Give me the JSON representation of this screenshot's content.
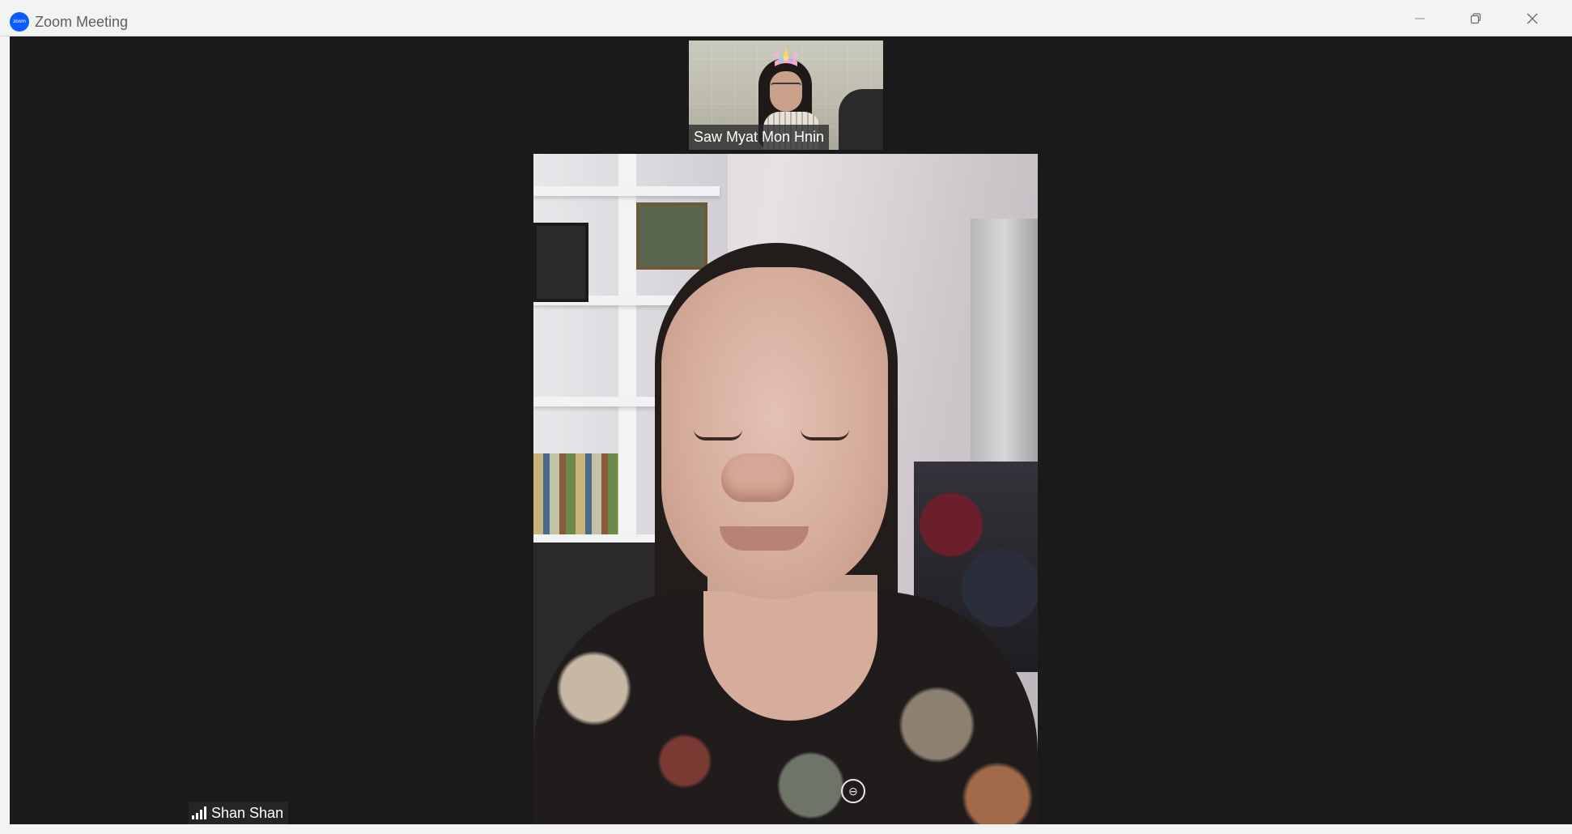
{
  "window": {
    "title": "Zoom Meeting",
    "logo_text": "zoom"
  },
  "controls": {
    "minimize_icon": "minimize-icon",
    "restore_icon": "restore-icon",
    "close_icon": "close-icon"
  },
  "participants": {
    "thumbnail": {
      "name": "Saw Myat Mon Hnin",
      "filter": "unicorn-headband"
    },
    "active_speaker": {
      "name": "Shan Shan",
      "connection_icon": "signal-bars-icon"
    }
  },
  "colors": {
    "title_bar": "#f3f3f3",
    "meeting_background": "#1a1a1a",
    "zoom_blue": "#0b5cff",
    "name_tag_bg": "#282828"
  }
}
